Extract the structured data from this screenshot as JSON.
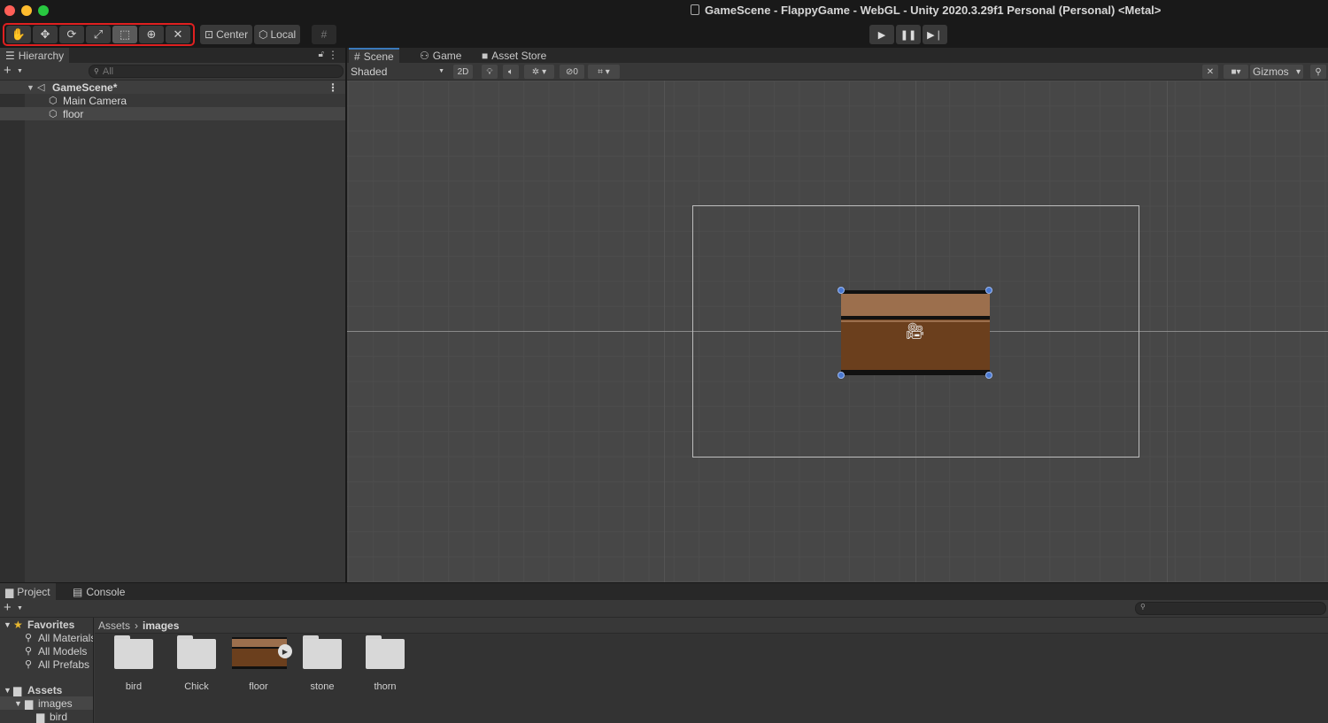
{
  "window": {
    "title": "GameScene - FlappyGame - WebGL - Unity 2020.3.29f1 Personal (Personal) <Metal>"
  },
  "toolbar": {
    "tools": [
      {
        "name": "hand-tool",
        "icon": "✋"
      },
      {
        "name": "move-tool",
        "icon": "✥"
      },
      {
        "name": "rotate-tool",
        "icon": "⟳"
      },
      {
        "name": "scale-tool",
        "icon": "⤢"
      },
      {
        "name": "rect-tool",
        "icon": "⬚"
      },
      {
        "name": "transform-tool",
        "icon": "⊕"
      },
      {
        "name": "custom-tool",
        "icon": "✕"
      }
    ],
    "active_tool_index": 4,
    "pivot_label": "Center",
    "space_label": "Local",
    "play_icon": "▶",
    "pause_icon": "❚❚",
    "step_icon": "▶❘"
  },
  "hierarchy": {
    "tab_label": "Hierarchy",
    "search_placeholder": "All",
    "scene_name": "GameScene*",
    "items": [
      {
        "label": "Main Camera"
      },
      {
        "label": "floor"
      }
    ]
  },
  "scene_view": {
    "tabs": [
      {
        "label": "Scene",
        "icon": "#"
      },
      {
        "label": "Game",
        "icon": "⚇"
      },
      {
        "label": "Asset Store",
        "icon": "■"
      }
    ],
    "shading_mode": "Shaded",
    "mode_2d_label": "2D",
    "hidden_count": "0",
    "gizmos_label": "Gizmos"
  },
  "project": {
    "tabs": [
      {
        "label": "Project"
      },
      {
        "label": "Console"
      }
    ],
    "favorites_label": "Favorites",
    "favorites": [
      {
        "label": "All Materials"
      },
      {
        "label": "All Models"
      },
      {
        "label": "All Prefabs"
      }
    ],
    "assets_label": "Assets",
    "tree": [
      {
        "label": "images"
      },
      {
        "label": "bird"
      }
    ],
    "breadcrumb": {
      "root": "Assets",
      "current": "images"
    },
    "assets": [
      {
        "label": "bird",
        "kind": "folder"
      },
      {
        "label": "Chick",
        "kind": "folder"
      },
      {
        "label": "floor",
        "kind": "sprite"
      },
      {
        "label": "stone",
        "kind": "folder"
      },
      {
        "label": "thorn",
        "kind": "folder"
      }
    ]
  },
  "colors": {
    "highlight_box": "#e02020",
    "selection_handle": "#4a78d0",
    "floor_dark": "#6b3f1d",
    "floor_light": "#9c6f4d"
  }
}
